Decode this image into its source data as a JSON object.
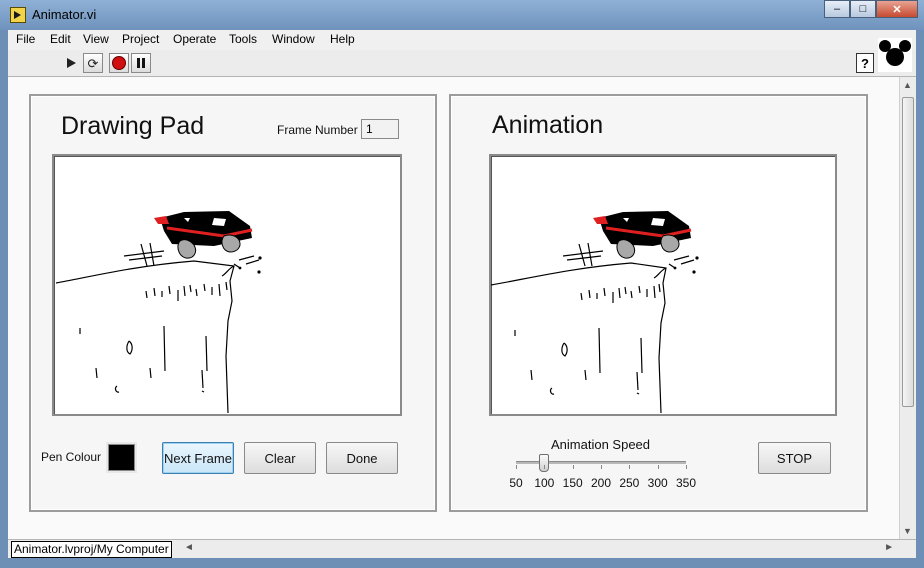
{
  "window": {
    "title": "Animator.vi",
    "buttons": {
      "minimize": "–",
      "maximize": "□",
      "close": "✕"
    }
  },
  "menu": [
    "File",
    "Edit",
    "View",
    "Project",
    "Operate",
    "Tools",
    "Window",
    "Help"
  ],
  "toolbar": {
    "icons": [
      "run-icon",
      "run-continuously-icon",
      "abort-icon",
      "pause-icon"
    ],
    "help_label": "?"
  },
  "drawing_pad": {
    "heading": "Drawing Pad",
    "frame_number_label": "Frame Number",
    "frame_number_value": "1",
    "pen_colour_label": "Pen Colour",
    "pen_colour": "#000000",
    "buttons": {
      "next_frame": "Next Frame",
      "clear": "Clear",
      "done": "Done"
    }
  },
  "animation": {
    "heading": "Animation",
    "speed_label": "Animation Speed",
    "speed_value": 100,
    "speed_min": 50,
    "speed_max": 350,
    "speed_ticks": [
      "50",
      "100",
      "150",
      "200",
      "250",
      "300",
      "350"
    ],
    "stop_label": "STOP"
  },
  "status": {
    "path": "Animator.lvproj/My Computer"
  },
  "colors": {
    "accent_red": "#d01010",
    "car_stripe": "#e02020",
    "wheel": "#a8a8a8"
  }
}
